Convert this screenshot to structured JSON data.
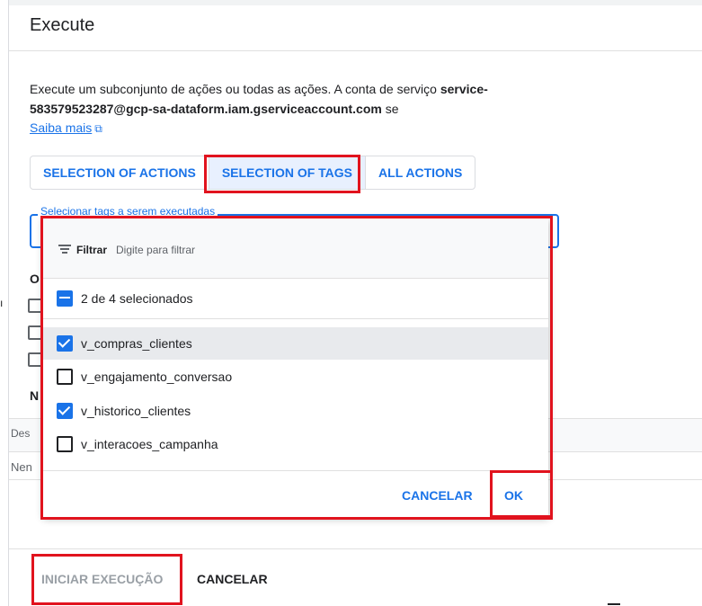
{
  "dialog": {
    "title": "Execute",
    "description_line1_prefix": "Execute um subconjunto de ações ou todas as ações. A conta de serviço ",
    "description_line1_bold": "service-",
    "description_line2_bold": "583579523287@gcp-sa-dataform.iam.gserviceaccount.com",
    "description_line2_suffix": " se",
    "learn_more": "Saiba mais",
    "learn_more_icon": "external-link-icon"
  },
  "tabs": [
    {
      "label": "SELECTION OF ACTIONS"
    },
    {
      "label": "SELECTION OF TAGS"
    },
    {
      "label": "ALL ACTIONS"
    }
  ],
  "tag_field": {
    "label": "Selecionar tags a serem executadas"
  },
  "background": {
    "options_initial": "O",
    "ne_initial": "N",
    "table_header": "Des",
    "table_empty": "Nen",
    "left_mark": "ı"
  },
  "dropdown": {
    "filter_label": "Filtrar",
    "filter_placeholder": "Digite para filtrar",
    "summary": "2 de 4 selecionados",
    "options": [
      {
        "label": "v_compras_clientes",
        "checked": true
      },
      {
        "label": "v_engajamento_conversao",
        "checked": false
      },
      {
        "label": "v_historico_clientes",
        "checked": true
      },
      {
        "label": "v_interacoes_campanha",
        "checked": false
      }
    ],
    "cancel": "CANCELAR",
    "ok": "OK"
  },
  "footer": {
    "start": "INICIAR EXECUÇÃO",
    "cancel": "CANCELAR"
  },
  "colors": {
    "accent": "#1a73e8",
    "highlight": "#e1131e"
  }
}
